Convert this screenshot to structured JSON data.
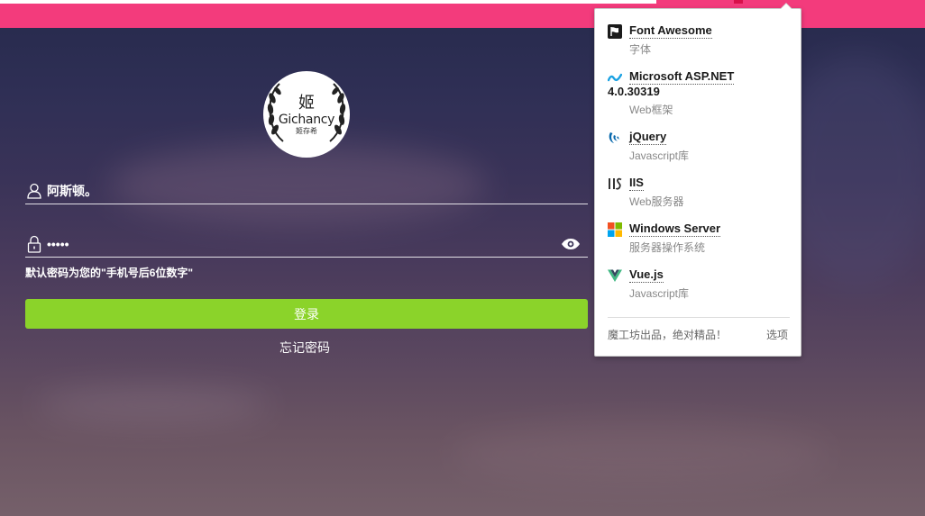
{
  "login": {
    "logo": {
      "glyph": "姬",
      "name": "Gichancy",
      "sub": "姬存希"
    },
    "username_value": "阿斯顿。",
    "password_value": "•••••",
    "hint": "默认密码为您的\"手机号后6位数字\"",
    "login_button": "登录",
    "forgot_link": "忘记密码",
    "colors": {
      "topbar": "#f33b7c",
      "login_button": "#8bd32a"
    }
  },
  "wappalyzer": {
    "apps": [
      {
        "name": "Font Awesome",
        "category": "字体",
        "icon": "flag-icon"
      },
      {
        "name": "Microsoft ASP.NET",
        "version": "4.0.30319",
        "category": "Web框架",
        "icon": "aspnet-icon"
      },
      {
        "name": "jQuery",
        "category": "Javascript库",
        "icon": "jquery-icon"
      },
      {
        "name": "IIS",
        "category": "Web服务器",
        "icon": "iis-icon"
      },
      {
        "name": "Windows Server",
        "category": "服务器操作系统",
        "icon": "windows-icon"
      },
      {
        "name": "Vue.js",
        "category": "Javascript库",
        "icon": "vue-icon"
      }
    ],
    "footer_left": "魔工坊出品，绝对精品！",
    "footer_right": "选项"
  }
}
